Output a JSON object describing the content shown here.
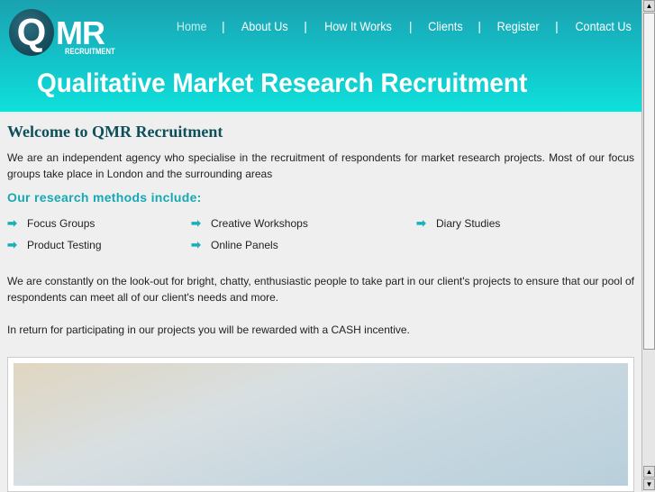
{
  "logo": {
    "letter": "Q",
    "text": "MR",
    "sub": "RECRUITMENT"
  },
  "nav": [
    {
      "label": "Home"
    },
    {
      "label": "About Us"
    },
    {
      "label": "How It Works"
    },
    {
      "label": "Clients"
    },
    {
      "label": "Register"
    },
    {
      "label": "Contact Us"
    }
  ],
  "nav_sep": "|",
  "banner": "Qualitative Market Research Recruitment",
  "main": {
    "title": "Welcome to QMR Recruitment",
    "intro": "We are an independent agency who specialise in the recruitment of respondents for market research projects. Most of our focus groups take place in London and the surrounding areas",
    "methods_heading": "Our research methods include:",
    "methods": [
      "Focus Groups",
      "Creative Workshops",
      "Diary Studies",
      "Product Testing",
      "Online Panels"
    ],
    "para2": "We are constantly on the look-out for bright, chatty, enthusiastic people to take part in our client's projects to ensure that our pool of respondents can meet all of our client's needs and more.",
    "para3": "In return for participating in our projects you will be rewarded with a CASH incentive."
  },
  "colors": {
    "accent": "#16a8b4",
    "title": "#0e4f5a"
  }
}
